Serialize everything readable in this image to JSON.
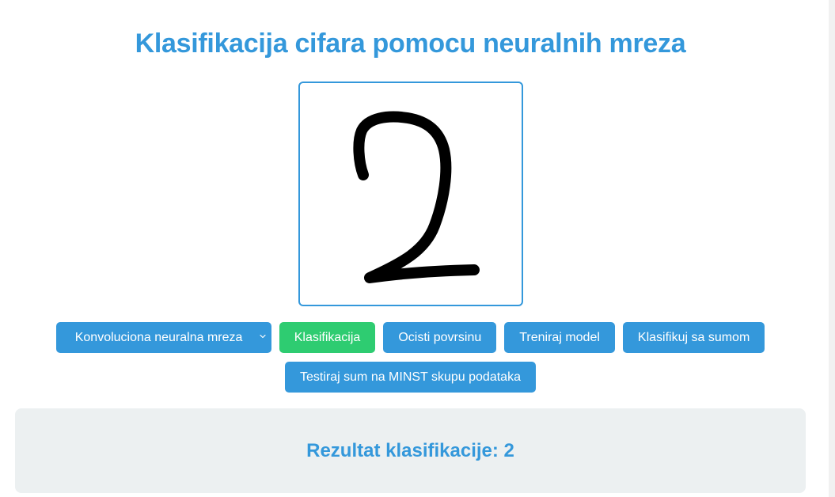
{
  "page": {
    "title": "Klasifikacija cifara pomocu neuralnih mreza"
  },
  "drawing_canvas": {
    "drawn_content": "handwritten digit 2"
  },
  "controls": {
    "model_select": {
      "selected": "Konvoluciona neuralna mreza"
    },
    "buttons": {
      "classify": "Klasifikacija",
      "clear": "Ocisti povrsinu",
      "train": "Treniraj model",
      "classify_noise": "Klasifikuj sa sumom",
      "test_noise": "Testiraj sum na MINST skupu podataka"
    }
  },
  "result": {
    "text": "Rezultat klasifikacije: 2"
  },
  "colors": {
    "primary": "#3498db",
    "success": "#2ecc71",
    "panel_bg": "#ecf0f1",
    "ink": "#000000"
  },
  "icons": {
    "select_arrow": "chevron-down-icon"
  }
}
